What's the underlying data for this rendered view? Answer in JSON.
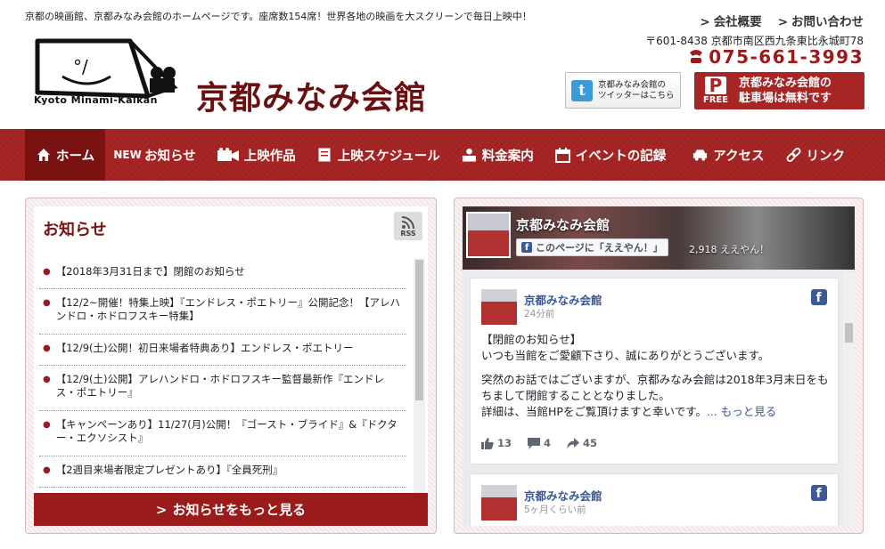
{
  "header": {
    "tagline": "京都の映画館、京都みなみ会館のホームページです。座席数154席！世界各地の映画を大スクリーンで毎日上映中！",
    "toplinks": [
      {
        "label": "会社概要"
      },
      {
        "label": "お問い合わせ"
      }
    ],
    "logo_text": "Kyoto Minami-Kaikan",
    "site_title": "京都みなみ会館",
    "address": "〒601-8438 京都市南区西九条東比永城町78",
    "phone": "075-661-3993",
    "twitter_line1": "京都みなみ会館の",
    "twitter_line2": "ツイッターはこちら",
    "parking_free": "FREE",
    "parking_p": "P",
    "parking_line1": "京都みなみ会館の",
    "parking_line2": "駐車場は無料です"
  },
  "nav": [
    {
      "label": "ホーム",
      "icon": "home-icon"
    },
    {
      "label": "お知らせ",
      "icon": "news-icon"
    },
    {
      "label": "上映作品",
      "icon": "camera-icon"
    },
    {
      "label": "上映スケジュール",
      "icon": "schedule-icon"
    },
    {
      "label": "料金案内",
      "icon": "ticket-icon"
    },
    {
      "label": "イベントの記録",
      "icon": "calendar-icon"
    },
    {
      "label": "アクセス",
      "icon": "car-icon"
    },
    {
      "label": "リンク",
      "icon": "link-icon"
    }
  ],
  "news": {
    "heading": "お知らせ",
    "rss": "RSS",
    "items": [
      "【2018年3月31日まで】閉館のお知らせ",
      "【12/2~開催！特集上映】『エンドレス・ポエトリー』公開記念！【アレハンドロ・ホドロフスキー特集】",
      "【12/9(土)公開！初日来場者特典あり】エンドレス・ポエトリー",
      "【12/9(土)公開】アレハンドロ・ホドロフスキー監督最新作『エンドレス・ポエトリー』",
      "【キャンペーンあり】11/27(月)公開！『ゴースト・ブライド』&『ドクター・エクソシスト』",
      "【2週目来場者限定プレゼントあり】『全員死刑』"
    ],
    "more_label": "お知らせをもっと見る"
  },
  "facebook": {
    "page_name": "京都みなみ会館",
    "like_label": "このページに「ええやん！」",
    "like_count": "2,918 ええやん！",
    "posts": [
      {
        "name": "京都みなみ会館",
        "time": "24分前",
        "para1_line1": "【閉館のお知らせ】",
        "para1_line2": "いつも当館をご愛顧下さり、誠にありがとうございます。",
        "para2": "突然のお話ではございますが、京都みなみ会館は2018年3月末日をもちまして閉館することとなりました。",
        "para3": "詳細は、当館HPをご覧頂けますと幸いです。",
        "more": "... もっと見る",
        "likes": "13",
        "comments": "4",
        "shares": "45"
      },
      {
        "name": "京都みなみ会館",
        "time": "5ヶ月くらい前"
      }
    ]
  },
  "colors": {
    "brand_red": "#a72525",
    "dark_red": "#7a1212",
    "fb_blue": "#3b5998"
  }
}
